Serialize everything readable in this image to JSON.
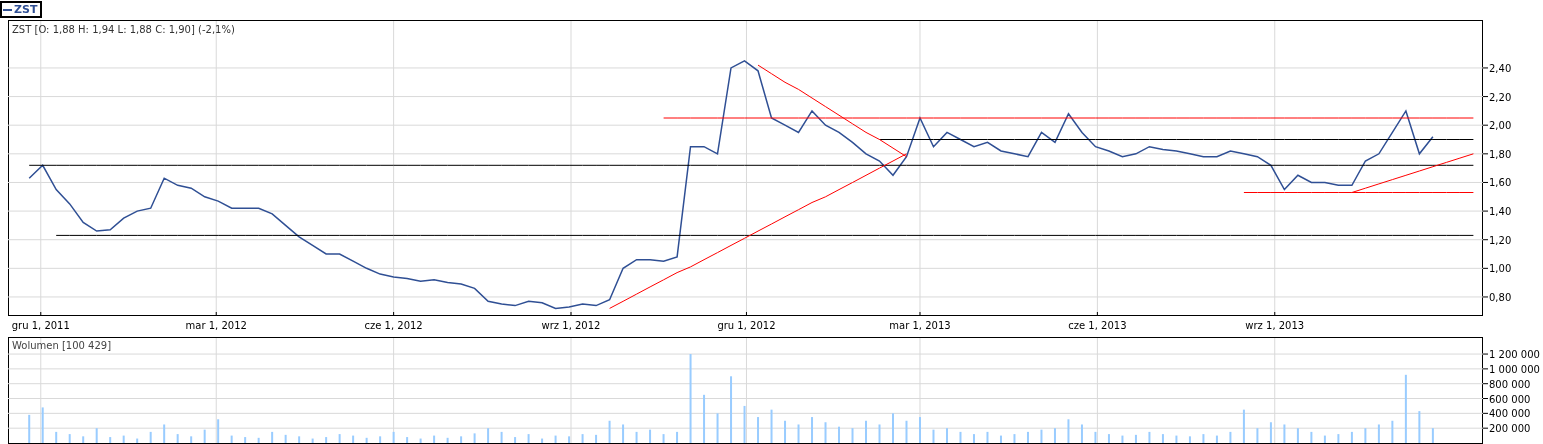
{
  "price_panel": {
    "chart_data": {
      "type": "line",
      "title": "ZST [O: 1,88  H: 1,94  L: 1,88  C: 1,90] (-2,1%)",
      "x": [
        "2011-11-25",
        "2011-12-02",
        "2011-12-09",
        "2011-12-16",
        "2011-12-23",
        "2011-12-30",
        "2012-01-06",
        "2012-01-13",
        "2012-01-20",
        "2012-01-27",
        "2012-02-03",
        "2012-02-10",
        "2012-02-17",
        "2012-02-24",
        "2012-03-02",
        "2012-03-09",
        "2012-03-16",
        "2012-03-23",
        "2012-03-30",
        "2012-04-06",
        "2012-04-13",
        "2012-04-20",
        "2012-04-27",
        "2012-05-04",
        "2012-05-11",
        "2012-05-18",
        "2012-05-25",
        "2012-06-01",
        "2012-06-08",
        "2012-06-15",
        "2012-06-22",
        "2012-06-29",
        "2012-07-06",
        "2012-07-13",
        "2012-07-20",
        "2012-07-27",
        "2012-08-03",
        "2012-08-10",
        "2012-08-17",
        "2012-08-24",
        "2012-08-31",
        "2012-09-07",
        "2012-09-14",
        "2012-09-21",
        "2012-09-28",
        "2012-10-05",
        "2012-10-12",
        "2012-10-19",
        "2012-10-26",
        "2012-11-02",
        "2012-11-09",
        "2012-11-16",
        "2012-11-23",
        "2012-11-30",
        "2012-12-07",
        "2012-12-14",
        "2012-12-21",
        "2012-12-28",
        "2013-01-04",
        "2013-01-11",
        "2013-01-18",
        "2013-01-25",
        "2013-02-01",
        "2013-02-08",
        "2013-02-15",
        "2013-02-22",
        "2013-03-01",
        "2013-03-08",
        "2013-03-15",
        "2013-03-22",
        "2013-03-29",
        "2013-04-05",
        "2013-04-12",
        "2013-04-19",
        "2013-04-26",
        "2013-05-03",
        "2013-05-10",
        "2013-05-17",
        "2013-05-24",
        "2013-05-31",
        "2013-06-07",
        "2013-06-14",
        "2013-06-21",
        "2013-06-28",
        "2013-07-05",
        "2013-07-12",
        "2013-07-19",
        "2013-07-26",
        "2013-08-02",
        "2013-08-09",
        "2013-08-16",
        "2013-08-23",
        "2013-08-30",
        "2013-09-06",
        "2013-09-13",
        "2013-09-20",
        "2013-09-27",
        "2013-10-04",
        "2013-10-11",
        "2013-10-18",
        "2013-10-25",
        "2013-11-01",
        "2013-11-08",
        "2013-11-15",
        "2013-11-22",
        "2013-11-29",
        "2013-12-06",
        "2013-12-13"
      ],
      "series": [
        {
          "name": "ZST",
          "color": "#2f4f94",
          "values": [
            1.63,
            1.72,
            1.55,
            1.45,
            1.32,
            1.26,
            1.27,
            1.35,
            1.4,
            1.42,
            1.63,
            1.58,
            1.56,
            1.5,
            1.47,
            1.42,
            1.42,
            1.42,
            1.38,
            1.3,
            1.22,
            1.16,
            1.1,
            1.1,
            1.05,
            1.0,
            0.96,
            0.94,
            0.93,
            0.91,
            0.92,
            0.9,
            0.89,
            0.86,
            0.77,
            0.75,
            0.74,
            0.77,
            0.76,
            0.72,
            0.73,
            0.75,
            0.74,
            0.78,
            1.0,
            1.06,
            1.06,
            1.05,
            1.08,
            1.85,
            1.85,
            1.8,
            2.4,
            2.45,
            2.38,
            2.05,
            2.0,
            1.95,
            2.1,
            2.0,
            1.95,
            1.88,
            1.8,
            1.75,
            1.65,
            1.78,
            2.05,
            1.85,
            1.95,
            1.9,
            1.85,
            1.88,
            1.82,
            1.8,
            1.78,
            1.95,
            1.88,
            2.08,
            1.95,
            1.85,
            1.82,
            1.78,
            1.8,
            1.85,
            1.83,
            1.82,
            1.8,
            1.78,
            1.78,
            1.82,
            1.8,
            1.78,
            1.72,
            1.55,
            1.65,
            1.6,
            1.6,
            1.58,
            1.58,
            1.75,
            1.8,
            1.95,
            2.1,
            1.8,
            1.92,
            null,
            null,
            null
          ]
        },
        {
          "color": "#000000",
          "values": [
            1.72,
            1.72,
            1.72,
            1.72,
            1.72,
            1.72,
            1.72,
            1.72,
            1.72,
            1.72,
            1.72,
            1.72,
            1.72,
            1.72,
            1.72,
            1.72,
            1.72,
            1.72,
            1.72,
            1.72,
            1.72,
            1.72,
            1.72,
            1.72,
            1.72,
            1.72,
            1.72,
            1.72,
            1.72,
            1.72,
            1.72,
            1.72,
            1.72,
            1.72,
            1.72,
            1.72,
            1.72,
            1.72,
            1.72,
            1.72,
            1.72,
            1.72,
            1.72,
            1.72,
            1.72,
            1.72,
            1.72,
            1.72,
            1.72,
            1.72,
            1.72,
            1.72,
            1.72,
            1.72,
            1.72,
            1.72,
            1.72,
            1.72,
            1.72,
            1.72,
            1.72,
            1.72,
            1.72,
            1.72,
            1.72,
            1.72,
            1.72,
            1.72,
            1.72,
            1.72,
            1.72,
            1.72,
            1.72,
            1.72,
            1.72,
            1.72,
            1.72,
            1.72,
            1.72,
            1.72,
            1.72,
            1.72,
            1.72,
            1.72,
            1.72,
            1.72,
            1.72,
            1.72,
            1.72,
            1.72,
            1.72,
            1.72,
            1.72,
            1.72,
            1.72,
            1.72,
            1.72,
            1.72,
            1.72,
            1.72,
            1.72,
            1.72,
            1.72,
            1.72,
            1.72,
            1.72,
            1.72,
            1.72
          ]
        },
        {
          "color": "#000000",
          "values": [
            null,
            null,
            null,
            null,
            null,
            null,
            null,
            null,
            null,
            null,
            null,
            null,
            null,
            null,
            null,
            null,
            null,
            null,
            null,
            null,
            null,
            null,
            null,
            null,
            null,
            null,
            null,
            null,
            null,
            null,
            null,
            null,
            null,
            null,
            null,
            null,
            null,
            null,
            null,
            null,
            null,
            null,
            null,
            null,
            null,
            null,
            null,
            null,
            null,
            null,
            null,
            null,
            null,
            null,
            null,
            null,
            null,
            null,
            null,
            null,
            null,
            null,
            null,
            1.9,
            1.9,
            1.9,
            1.9,
            1.9,
            1.9,
            1.9,
            1.9,
            1.9,
            1.9,
            1.9,
            1.9,
            1.9,
            1.9,
            1.9,
            1.9,
            1.9,
            1.9,
            1.9,
            1.9,
            1.9,
            1.9,
            1.9,
            1.9,
            1.9,
            1.9,
            1.9,
            1.9,
            1.9,
            1.9,
            1.9,
            1.9,
            1.9,
            1.9,
            1.9,
            1.9,
            1.9,
            1.9,
            1.9,
            1.9,
            1.9,
            1.9,
            1.9,
            1.9,
            1.9
          ]
        },
        {
          "color": "#000000",
          "values": [
            null,
            null,
            1.23,
            1.23,
            1.23,
            1.23,
            1.23,
            1.23,
            1.23,
            1.23,
            1.23,
            1.23,
            1.23,
            1.23,
            1.23,
            1.23,
            1.23,
            1.23,
            1.23,
            1.23,
            1.23,
            1.23,
            1.23,
            1.23,
            1.23,
            1.23,
            1.23,
            1.23,
            1.23,
            1.23,
            1.23,
            1.23,
            1.23,
            1.23,
            1.23,
            1.23,
            1.23,
            1.23,
            1.23,
            1.23,
            1.23,
            1.23,
            1.23,
            1.23,
            1.23,
            1.23,
            1.23,
            1.23,
            1.23,
            1.23,
            1.23,
            1.23,
            1.23,
            1.23,
            1.23,
            1.23,
            1.23,
            1.23,
            1.23,
            1.23,
            1.23,
            1.23,
            1.23,
            1.23,
            1.23,
            1.23,
            1.23,
            1.23,
            1.23,
            1.23,
            1.23,
            1.23,
            1.23,
            1.23,
            1.23,
            1.23,
            1.23,
            1.23,
            1.23,
            1.23,
            1.23,
            1.23,
            1.23,
            1.23,
            1.23,
            1.23,
            1.23,
            1.23,
            1.23,
            1.23,
            1.23,
            1.23,
            1.23,
            1.23,
            1.23,
            1.23,
            1.23,
            1.23,
            1.23,
            1.23,
            1.23,
            1.23,
            1.23,
            1.23,
            1.23,
            1.23,
            1.23,
            1.23
          ]
        },
        {
          "color": "#ff0000",
          "values": [
            null,
            null,
            null,
            null,
            null,
            null,
            null,
            null,
            null,
            null,
            null,
            null,
            null,
            null,
            null,
            null,
            null,
            null,
            null,
            null,
            null,
            null,
            null,
            null,
            null,
            null,
            null,
            null,
            null,
            null,
            null,
            null,
            null,
            null,
            null,
            null,
            null,
            null,
            null,
            null,
            null,
            null,
            null,
            null,
            null,
            null,
            null,
            2.05,
            2.05,
            2.05,
            2.05,
            2.05,
            2.05,
            2.05,
            2.05,
            2.05,
            2.05,
            2.05,
            2.05,
            2.05,
            2.05,
            2.05,
            2.05,
            2.05,
            2.05,
            2.05,
            2.05,
            2.05,
            2.05,
            2.05,
            2.05,
            2.05,
            2.05,
            2.05,
            2.05,
            2.05,
            2.05,
            2.05,
            2.05,
            2.05,
            2.05,
            2.05,
            2.05,
            2.05,
            2.05,
            2.05,
            2.05,
            2.05,
            2.05,
            2.05,
            2.05,
            2.05,
            2.05,
            2.05,
            2.05,
            2.05,
            2.05,
            2.05,
            2.05,
            2.05,
            2.05,
            2.05,
            2.05,
            2.05,
            2.05,
            2.05,
            2.05,
            2.05
          ]
        },
        {
          "color": "#ff0000",
          "values": [
            null,
            null,
            null,
            null,
            null,
            null,
            null,
            null,
            null,
            null,
            null,
            null,
            null,
            null,
            null,
            null,
            null,
            null,
            null,
            null,
            null,
            null,
            null,
            null,
            null,
            null,
            null,
            null,
            null,
            null,
            null,
            null,
            null,
            null,
            null,
            null,
            null,
            null,
            null,
            null,
            null,
            null,
            null,
            null,
            null,
            null,
            null,
            null,
            null,
            null,
            null,
            null,
            null,
            null,
            null,
            null,
            null,
            null,
            null,
            null,
            null,
            null,
            null,
            null,
            null,
            null,
            null,
            null,
            null,
            null,
            null,
            null,
            null,
            null,
            null,
            null,
            null,
            null,
            null,
            null,
            null,
            null,
            null,
            null,
            null,
            null,
            null,
            null,
            null,
            null,
            1.53,
            1.53,
            1.53,
            1.53,
            1.53,
            1.53,
            1.53,
            1.53,
            1.53,
            1.53,
            1.53,
            1.53,
            1.53,
            1.53,
            1.53,
            1.53,
            1.53,
            1.53
          ]
        },
        {
          "color": "#ff0000",
          "values": [
            null,
            null,
            null,
            null,
            null,
            null,
            null,
            null,
            null,
            null,
            null,
            null,
            null,
            null,
            null,
            null,
            null,
            null,
            null,
            null,
            null,
            null,
            null,
            null,
            null,
            null,
            null,
            null,
            null,
            null,
            null,
            null,
            null,
            null,
            null,
            null,
            null,
            null,
            null,
            null,
            null,
            null,
            null,
            0.72,
            0.77,
            0.82,
            0.87,
            0.92,
            0.97,
            1.01,
            1.06,
            1.11,
            1.16,
            1.21,
            1.26,
            1.31,
            1.36,
            1.41,
            1.46,
            1.5,
            1.55,
            1.6,
            1.65,
            1.7,
            1.75,
            1.8,
            null,
            null,
            null,
            null,
            null,
            null,
            null,
            null,
            null,
            null,
            null,
            null,
            null,
            null,
            null,
            null,
            null,
            null,
            null,
            null,
            null,
            null,
            null,
            null,
            null,
            null,
            null,
            null,
            null,
            null,
            null,
            null,
            null,
            null,
            null,
            null,
            null,
            null,
            null,
            null,
            null,
            null
          ]
        },
        {
          "color": "#ff0000",
          "values": [
            null,
            null,
            null,
            null,
            null,
            null,
            null,
            null,
            null,
            null,
            null,
            null,
            null,
            null,
            null,
            null,
            null,
            null,
            null,
            null,
            null,
            null,
            null,
            null,
            null,
            null,
            null,
            null,
            null,
            null,
            null,
            null,
            null,
            null,
            null,
            null,
            null,
            null,
            null,
            null,
            null,
            null,
            null,
            null,
            null,
            null,
            null,
            null,
            null,
            null,
            null,
            null,
            null,
            null,
            2.42,
            2.36,
            2.3,
            2.25,
            2.19,
            2.13,
            2.07,
            2.01,
            1.95,
            1.9,
            1.84,
            1.78,
            null,
            null,
            null,
            null,
            null,
            null,
            null,
            null,
            null,
            null,
            null,
            null,
            null,
            null,
            null,
            null,
            null,
            null,
            null,
            null,
            null,
            null,
            null,
            null,
            null,
            null,
            null,
            null,
            null,
            null,
            null,
            null,
            null,
            null,
            null,
            null,
            null,
            null,
            null,
            null,
            null,
            null
          ]
        },
        {
          "color": "#ff0000",
          "values": [
            null,
            null,
            null,
            null,
            null,
            null,
            null,
            null,
            null,
            null,
            null,
            null,
            null,
            null,
            null,
            null,
            null,
            null,
            null,
            null,
            null,
            null,
            null,
            null,
            null,
            null,
            null,
            null,
            null,
            null,
            null,
            null,
            null,
            null,
            null,
            null,
            null,
            null,
            null,
            null,
            null,
            null,
            null,
            null,
            null,
            null,
            null,
            null,
            null,
            null,
            null,
            null,
            null,
            null,
            null,
            null,
            null,
            null,
            null,
            null,
            null,
            null,
            null,
            null,
            null,
            null,
            null,
            null,
            null,
            null,
            null,
            null,
            null,
            null,
            null,
            null,
            null,
            null,
            null,
            null,
            null,
            null,
            null,
            null,
            null,
            null,
            null,
            null,
            null,
            null,
            null,
            null,
            null,
            null,
            null,
            null,
            null,
            null,
            1.53,
            1.56,
            1.59,
            1.62,
            1.65,
            1.68,
            1.71,
            1.74,
            1.77,
            1.8
          ]
        }
      ],
      "xlim": [
        "2011-11-14",
        "2013-12-18"
      ],
      "ylim": [
        0.667,
        2.735
      ],
      "xticks": [
        {
          "value": "2011-12-01",
          "label": "gru 1, 2011"
        },
        {
          "value": "2012-03-01",
          "label": "mar 1, 2012"
        },
        {
          "value": "2012-06-01",
          "label": "cze 1, 2012"
        },
        {
          "value": "2012-09-01",
          "label": "wrz 1, 2012"
        },
        {
          "value": "2012-12-01",
          "label": "gru 1, 2012"
        },
        {
          "value": "2013-03-01",
          "label": "mar 1, 2013"
        },
        {
          "value": "2013-06-01",
          "label": "cze 1, 2013"
        },
        {
          "value": "2013-09-01",
          "label": "wrz 1, 2013"
        }
      ],
      "yticks": [
        {
          "value": 0.8,
          "label": "0,80"
        },
        {
          "value": 1.0,
          "label": "1,00"
        },
        {
          "value": 1.2,
          "label": "1,20"
        },
        {
          "value": 1.4,
          "label": "1,40"
        },
        {
          "value": 1.6,
          "label": "1,60"
        },
        {
          "value": 1.8,
          "label": "1,80"
        },
        {
          "value": 2.0,
          "label": "2,00"
        },
        {
          "value": 2.2,
          "label": "2,20"
        },
        {
          "value": 2.4,
          "label": "2,40"
        }
      ],
      "grid": true
    }
  },
  "volume_panel": {
    "chart_data": {
      "type": "bar",
      "title": "Wolumen [100 429]",
      "x": [
        "2011-11-25",
        "2011-12-02",
        "2011-12-09",
        "2011-12-16",
        "2011-12-23",
        "2011-12-30",
        "2012-01-06",
        "2012-01-13",
        "2012-01-20",
        "2012-01-27",
        "2012-02-03",
        "2012-02-10",
        "2012-02-17",
        "2012-02-24",
        "2012-03-02",
        "2012-03-09",
        "2012-03-16",
        "2012-03-23",
        "2012-03-30",
        "2012-04-06",
        "2012-04-13",
        "2012-04-20",
        "2012-04-27",
        "2012-05-04",
        "2012-05-11",
        "2012-05-18",
        "2012-05-25",
        "2012-06-01",
        "2012-06-08",
        "2012-06-15",
        "2012-06-22",
        "2012-06-29",
        "2012-07-06",
        "2012-07-13",
        "2012-07-20",
        "2012-07-27",
        "2012-08-03",
        "2012-08-10",
        "2012-08-17",
        "2012-08-24",
        "2012-08-31",
        "2012-09-07",
        "2012-09-14",
        "2012-09-21",
        "2012-09-28",
        "2012-10-05",
        "2012-10-12",
        "2012-10-19",
        "2012-10-26",
        "2012-11-02",
        "2012-11-09",
        "2012-11-16",
        "2012-11-23",
        "2012-11-30",
        "2012-12-07",
        "2012-12-14",
        "2012-12-21",
        "2012-12-28",
        "2013-01-04",
        "2013-01-11",
        "2013-01-18",
        "2013-01-25",
        "2013-02-01",
        "2013-02-08",
        "2013-02-15",
        "2013-02-22",
        "2013-03-01",
        "2013-03-08",
        "2013-03-15",
        "2013-03-22",
        "2013-03-29",
        "2013-04-05",
        "2013-04-12",
        "2013-04-19",
        "2013-04-26",
        "2013-05-03",
        "2013-05-10",
        "2013-05-17",
        "2013-05-24",
        "2013-05-31",
        "2013-06-07",
        "2013-06-14",
        "2013-06-21",
        "2013-06-28",
        "2013-07-05",
        "2013-07-12",
        "2013-07-19",
        "2013-07-26",
        "2013-08-02",
        "2013-08-09",
        "2013-08-16",
        "2013-08-23",
        "2013-08-30",
        "2013-09-06",
        "2013-09-13",
        "2013-09-20",
        "2013-09-27",
        "2013-10-04",
        "2013-10-11",
        "2013-10-18",
        "2013-10-25",
        "2013-11-01",
        "2013-11-08",
        "2013-11-15",
        "2013-11-22"
      ],
      "series": [
        {
          "color": "#99ccff",
          "values": [
            380000,
            480000,
            150000,
            120000,
            90000,
            200000,
            80000,
            100000,
            60000,
            150000,
            250000,
            120000,
            90000,
            180000,
            320000,
            100000,
            80000,
            70000,
            150000,
            110000,
            90000,
            60000,
            80000,
            120000,
            100000,
            70000,
            90000,
            150000,
            80000,
            60000,
            100000,
            70000,
            90000,
            130000,
            200000,
            150000,
            80000,
            120000,
            60000,
            100000,
            90000,
            120000,
            110000,
            300000,
            250000,
            150000,
            180000,
            120000,
            150000,
            1200000,
            650000,
            400000,
            900000,
            500000,
            350000,
            450000,
            300000,
            250000,
            350000,
            280000,
            220000,
            200000,
            300000,
            250000,
            400000,
            300000,
            350000,
            180000,
            200000,
            150000,
            120000,
            150000,
            100000,
            120000,
            150000,
            180000,
            200000,
            320000,
            250000,
            150000,
            120000,
            100000,
            110000,
            150000,
            120000,
            100000,
            90000,
            120000,
            100000,
            150000,
            450000,
            200000,
            280000,
            250000,
            200000,
            150000,
            100000,
            120000,
            150000,
            200000,
            250000,
            300000,
            920000,
            430000,
            200000
          ]
        }
      ],
      "xlim": [
        "2011-11-14",
        "2013-12-18"
      ],
      "ylim": [
        0,
        1430000
      ],
      "grid": true,
      "yticks": [
        {
          "value": 200000,
          "label": "200 000"
        },
        {
          "value": 400000,
          "label": "400 000"
        },
        {
          "value": 600000,
          "label": "600 000"
        },
        {
          "value": 800000,
          "label": "800 000"
        },
        {
          "value": 1000000,
          "label": "1 000 000"
        },
        {
          "value": 1200000,
          "label": "1 200 000"
        }
      ]
    }
  }
}
